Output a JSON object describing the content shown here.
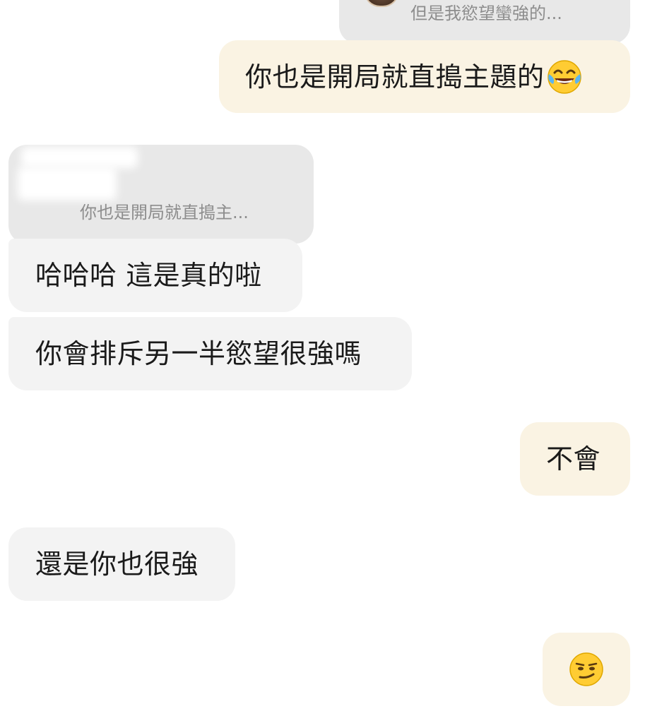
{
  "messages": {
    "quote_top": "但是我慾望蠻強的...",
    "mine_1": "你也是開局就直搗主題的",
    "quote_reply": "你也是開局就直搗主...",
    "theirs_1": "哈哈哈 這是真的啦",
    "theirs_2": "你會排斥另一半慾望很強嗎",
    "mine_2": "不會",
    "theirs_3": "還是你也很強"
  },
  "icons": {
    "mine_1_emoji": "face-with-tears-of-joy-icon",
    "mine_3_emoji": "smirking-face-icon"
  },
  "colors": {
    "mine_bubble": "#faf3e3",
    "theirs_bubble": "#f3f3f3",
    "quote_bubble": "#e8e8e8",
    "quote_text": "#8d8d8d"
  }
}
